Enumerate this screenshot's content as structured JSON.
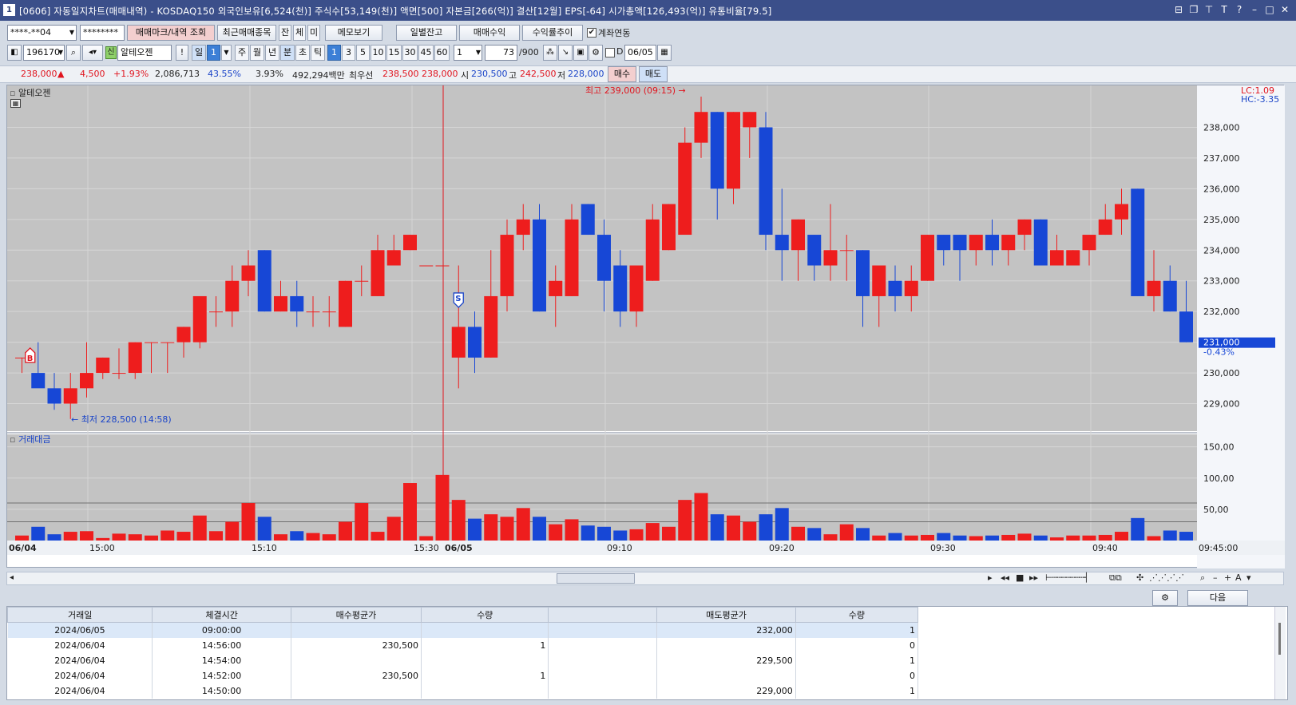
{
  "title": {
    "num": "1",
    "text": "[0606] 자동일지차트(매매내역) - KOSDAQ150 외국인보유[6,524(천)] 주식수[53,149(천)] 액면[500] 자본금[266(억)] 결산[12월] EPS[-64] 시가총액[126,493(억)] 유통비율[79.5]"
  },
  "toolbar1": {
    "account": "****-**04",
    "password": "********",
    "mark_btn": "매매마크/내역 조회",
    "recent_btn": "최근매매종목",
    "t_jan": "잔",
    "t_che": "체",
    "t_mi": "미",
    "memo_btn": "메모보기",
    "daily_btn": "일별잔고",
    "profit_btn": "매매수익",
    "rate_btn": "수익률추이",
    "link_label": "계좌연동"
  },
  "toolbar2": {
    "code": "196170",
    "credit": "신",
    "name": "알테오젠",
    "bang": "!",
    "day": "일",
    "count": "1",
    "periods": [
      "주",
      "월",
      "년",
      "분",
      "초",
      "틱"
    ],
    "minutes": [
      "1",
      "3",
      "5",
      "10",
      "15",
      "30",
      "45",
      "60"
    ],
    "unit": "1",
    "bars": "73",
    "bars_total": "/900",
    "date": "06/05"
  },
  "quote": {
    "price": "238,000",
    "arrow": "▲",
    "change": "4,500",
    "rate": "+1.93%",
    "volume": "2,086,713",
    "pct1": "43.55%",
    "pct2": "3.93%",
    "amount": "492,294백만",
    "best_label": "최우선",
    "best_ask": "238,500",
    "best_bid": "238,000",
    "open_label": "시",
    "open": "230,500",
    "high_label": "고",
    "high": "242,500",
    "low_label": "저",
    "low": "228,000",
    "buy_btn": "매수",
    "sell_btn": "매도"
  },
  "chart": {
    "stock_label": "알테오젠",
    "lc": "LC:1.09",
    "hc": "HC:-3.35",
    "price_ticks": [
      "238,000",
      "237,000",
      "236,000",
      "235,000",
      "234,000",
      "233,000",
      "232,000",
      "231,000",
      "230,000",
      "229,000"
    ],
    "current_price_tag": "231,000",
    "current_rate_tag": "-0.43%",
    "high_annot": "최고 239,000 (09:15)",
    "low_annot": "최저 228,500 (14:58)",
    "buy_marker": "B",
    "sell_marker": "S",
    "volume_label": "거래대금",
    "vol_ticks": [
      "150,00",
      "100,00",
      "50,00"
    ],
    "x_labels": [
      "06/04",
      "15:00",
      "15:10",
      "15:30",
      "06/05",
      "09:10",
      "09:20",
      "09:30",
      "09:40",
      "09:45:00"
    ],
    "colors": {
      "up": "#ee1d1d",
      "down": "#1747d6",
      "bg": "#c3c3c3"
    }
  },
  "chart_data": {
    "type": "candlestick",
    "series": [
      {
        "name": "",
        "o": 230.5,
        "h": 230.5,
        "l": 230.0,
        "c": 230.5
      },
      {
        "name": "",
        "o": 230.0,
        "h": 231.0,
        "l": 229.8,
        "c": 229.5
      },
      {
        "name": "",
        "o": 229.5,
        "h": 230.0,
        "l": 228.8,
        "c": 229.0
      },
      {
        "name": "",
        "o": 229.0,
        "h": 230.0,
        "l": 228.5,
        "c": 229.5
      },
      {
        "name": "",
        "o": 229.5,
        "h": 231.0,
        "l": 229.2,
        "c": 230.0
      },
      {
        "name": "",
        "o": 230.0,
        "h": 230.5,
        "l": 229.8,
        "c": 230.5
      },
      {
        "name": "",
        "o": 230.0,
        "h": 230.8,
        "l": 229.8,
        "c": 230.0
      },
      {
        "name": "",
        "o": 230.0,
        "h": 231.0,
        "l": 229.8,
        "c": 231.0
      },
      {
        "name": "",
        "o": 231.0,
        "h": 231.0,
        "l": 230.0,
        "c": 231.0
      },
      {
        "name": "",
        "o": 231.0,
        "h": 231.0,
        "l": 230.0,
        "c": 231.0
      },
      {
        "name": "",
        "o": 231.0,
        "h": 231.5,
        "l": 230.5,
        "c": 231.5
      },
      {
        "name": "",
        "o": 231.0,
        "h": 232.5,
        "l": 230.8,
        "c": 232.5
      },
      {
        "name": "",
        "o": 232.0,
        "h": 232.5,
        "l": 231.5,
        "c": 232.0
      },
      {
        "name": "",
        "o": 232.0,
        "h": 233.5,
        "l": 231.5,
        "c": 233.0
      },
      {
        "name": "",
        "o": 233.0,
        "h": 234.0,
        "l": 232.5,
        "c": 233.5
      },
      {
        "name": "",
        "o": 234.0,
        "h": 234.0,
        "l": 232.0,
        "c": 232.0
      },
      {
        "name": "",
        "o": 232.0,
        "h": 233.0,
        "l": 232.0,
        "c": 232.5
      },
      {
        "name": "",
        "o": 232.5,
        "h": 233.0,
        "l": 231.5,
        "c": 232.0
      },
      {
        "name": "",
        "o": 232.0,
        "h": 232.5,
        "l": 231.5,
        "c": 232.0
      },
      {
        "name": "",
        "o": 232.0,
        "h": 232.5,
        "l": 231.5,
        "c": 232.0
      },
      {
        "name": "",
        "o": 231.5,
        "h": 233.0,
        "l": 231.5,
        "c": 233.0
      },
      {
        "name": "",
        "o": 233.0,
        "h": 233.5,
        "l": 232.5,
        "c": 233.0
      },
      {
        "name": "",
        "o": 232.5,
        "h": 234.5,
        "l": 232.5,
        "c": 234.0
      },
      {
        "name": "",
        "o": 233.5,
        "h": 234.5,
        "l": 233.5,
        "c": 234.0
      },
      {
        "name": "",
        "o": 234.0,
        "h": 234.5,
        "l": 234.0,
        "c": 234.5
      },
      {
        "name": "",
        "o": 233.5,
        "h": 233.5,
        "l": 233.5,
        "c": 233.5
      },
      {
        "name": "",
        "o": 233.5,
        "h": 233.5,
        "l": 233.5,
        "c": 233.5
      },
      {
        "name": "",
        "o": 230.5,
        "h": 233.5,
        "l": 229.5,
        "c": 231.5
      },
      {
        "name": "",
        "o": 231.5,
        "h": 232.0,
        "l": 230.0,
        "c": 230.5
      },
      {
        "name": "",
        "o": 230.5,
        "h": 234.0,
        "l": 230.5,
        "c": 232.5
      },
      {
        "name": "",
        "o": 232.5,
        "h": 235.0,
        "l": 232.0,
        "c": 234.5
      },
      {
        "name": "",
        "o": 234.5,
        "h": 235.5,
        "l": 234.0,
        "c": 235.0
      },
      {
        "name": "",
        "o": 235.0,
        "h": 235.5,
        "l": 232.0,
        "c": 232.0
      },
      {
        "name": "",
        "o": 232.5,
        "h": 233.5,
        "l": 231.5,
        "c": 233.0
      },
      {
        "name": "",
        "o": 232.5,
        "h": 235.5,
        "l": 232.5,
        "c": 235.0
      },
      {
        "name": "",
        "o": 235.5,
        "h": 235.5,
        "l": 234.5,
        "c": 234.5
      },
      {
        "name": "",
        "o": 234.5,
        "h": 235.0,
        "l": 232.0,
        "c": 233.0
      },
      {
        "name": "",
        "o": 233.5,
        "h": 234.0,
        "l": 231.5,
        "c": 232.0
      },
      {
        "name": "",
        "o": 232.0,
        "h": 233.5,
        "l": 231.5,
        "c": 233.5
      },
      {
        "name": "",
        "o": 233.0,
        "h": 235.5,
        "l": 233.0,
        "c": 235.0
      },
      {
        "name": "",
        "o": 234.0,
        "h": 235.5,
        "l": 234.0,
        "c": 235.5
      },
      {
        "name": "",
        "o": 234.5,
        "h": 238.0,
        "l": 234.5,
        "c": 237.5
      },
      {
        "name": "",
        "o": 237.5,
        "h": 239.0,
        "l": 237.0,
        "c": 238.5
      },
      {
        "name": "",
        "o": 238.5,
        "h": 238.5,
        "l": 235.0,
        "c": 236.0
      },
      {
        "name": "",
        "o": 236.0,
        "h": 238.5,
        "l": 235.5,
        "c": 238.5
      },
      {
        "name": "",
        "o": 238.0,
        "h": 238.5,
        "l": 237.0,
        "c": 238.5
      },
      {
        "name": "",
        "o": 238.0,
        "h": 238.5,
        "l": 234.0,
        "c": 234.5
      },
      {
        "name": "",
        "o": 234.5,
        "h": 236.0,
        "l": 233.0,
        "c": 234.0
      },
      {
        "name": "",
        "o": 234.0,
        "h": 235.0,
        "l": 233.0,
        "c": 235.0
      },
      {
        "name": "",
        "o": 234.5,
        "h": 234.5,
        "l": 233.0,
        "c": 233.5
      },
      {
        "name": "",
        "o": 233.5,
        "h": 235.5,
        "l": 233.0,
        "c": 234.0
      },
      {
        "name": "",
        "o": 234.0,
        "h": 234.5,
        "l": 233.0,
        "c": 234.0
      },
      {
        "name": "",
        "o": 234.0,
        "h": 234.0,
        "l": 231.5,
        "c": 232.5
      },
      {
        "name": "",
        "o": 232.5,
        "h": 233.5,
        "l": 231.5,
        "c": 233.5
      },
      {
        "name": "",
        "o": 233.0,
        "h": 233.5,
        "l": 232.0,
        "c": 232.5
      },
      {
        "name": "",
        "o": 232.5,
        "h": 233.5,
        "l": 232.0,
        "c": 233.0
      },
      {
        "name": "",
        "o": 233.0,
        "h": 234.5,
        "l": 233.0,
        "c": 234.5
      },
      {
        "name": "",
        "o": 234.5,
        "h": 234.5,
        "l": 233.5,
        "c": 234.0
      },
      {
        "name": "",
        "o": 234.5,
        "h": 234.5,
        "l": 233.0,
        "c": 234.0
      },
      {
        "name": "",
        "o": 234.0,
        "h": 234.5,
        "l": 233.5,
        "c": 234.5
      },
      {
        "name": "",
        "o": 234.5,
        "h": 235.0,
        "l": 233.5,
        "c": 234.0
      },
      {
        "name": "",
        "o": 234.0,
        "h": 234.5,
        "l": 233.5,
        "c": 234.5
      },
      {
        "name": "",
        "o": 234.5,
        "h": 235.0,
        "l": 234.0,
        "c": 235.0
      },
      {
        "name": "",
        "o": 235.0,
        "h": 235.0,
        "l": 233.5,
        "c": 233.5
      },
      {
        "name": "",
        "o": 233.5,
        "h": 234.5,
        "l": 233.5,
        "c": 234.0
      },
      {
        "name": "",
        "o": 233.5,
        "h": 234.0,
        "l": 233.5,
        "c": 234.0
      },
      {
        "name": "",
        "o": 234.0,
        "h": 234.5,
        "l": 233.5,
        "c": 234.5
      },
      {
        "name": "",
        "o": 234.5,
        "h": 235.5,
        "l": 234.5,
        "c": 235.0
      },
      {
        "name": "",
        "o": 235.0,
        "h": 236.0,
        "l": 234.5,
        "c": 235.5
      },
      {
        "name": "",
        "o": 236.0,
        "h": 236.0,
        "l": 232.5,
        "c": 232.5
      },
      {
        "name": "",
        "o": 232.5,
        "h": 234.0,
        "l": 232.0,
        "c": 233.0
      },
      {
        "name": "",
        "o": 233.0,
        "h": 233.5,
        "l": 232.0,
        "c": 232.0
      },
      {
        "name": "",
        "o": 232.0,
        "h": 233.0,
        "l": 231.0,
        "c": 231.0
      }
    ],
    "volume": [
      8,
      22,
      10,
      14,
      15,
      4,
      11,
      10,
      8,
      16,
      14,
      40,
      15,
      30,
      60,
      38,
      10,
      15,
      12,
      10,
      30,
      60,
      14,
      38,
      92,
      7,
      105,
      65,
      35,
      42,
      38,
      52,
      38,
      26,
      34,
      24,
      22,
      16,
      18,
      28,
      22,
      65,
      76,
      42,
      40,
      30,
      42,
      52,
      22,
      20,
      10,
      26,
      20,
      8,
      12,
      8,
      9,
      12,
      8,
      7,
      8,
      9,
      11,
      8,
      5,
      8,
      8,
      9,
      14,
      36,
      7,
      16,
      14,
      22
    ],
    "ylim": [
      228.0,
      239.0
    ],
    "vol_ylim": [
      0,
      170
    ]
  },
  "trades": {
    "headers": [
      "거래일",
      "체결시간",
      "매수평균가",
      "수량",
      "",
      "매도평균가",
      "수량"
    ],
    "rows": [
      [
        "2024/06/05",
        "09:00:00",
        "",
        "",
        "",
        "232,000",
        "1"
      ],
      [
        "2024/06/04",
        "14:56:00",
        "230,500",
        "1",
        "",
        "",
        "0"
      ],
      [
        "2024/06/04",
        "14:54:00",
        "",
        "",
        "",
        "229,500",
        "1"
      ],
      [
        "2024/06/04",
        "14:52:00",
        "230,500",
        "1",
        "",
        "",
        "0"
      ],
      [
        "2024/06/04",
        "14:50:00",
        "",
        "",
        "",
        "229,000",
        "1"
      ]
    ],
    "next_btn": "다음"
  }
}
